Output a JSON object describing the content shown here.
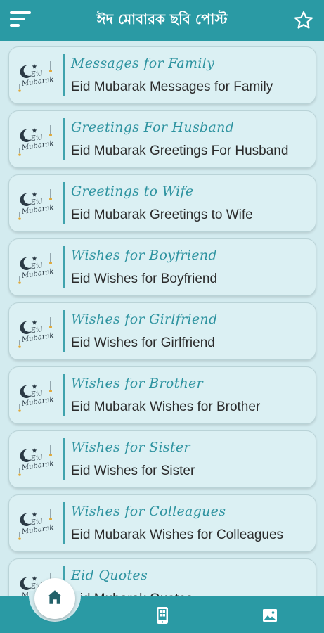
{
  "header": {
    "title": "ঈদ মোবারক ছবি পোস্ট",
    "menu_icon": "hamburger-menu-icon",
    "favorite_icon": "star-outline-icon"
  },
  "colors": {
    "primary": "#2a9aa4",
    "background": "#d3ebef",
    "card_title": "#2e93a0"
  },
  "list": {
    "items": [
      {
        "title": "Messages for Family",
        "subtitle": "Eid Mubarak Messages for Family",
        "thumb_text": "Eid Mubarak"
      },
      {
        "title": "Greetings For Husband",
        "subtitle": "Eid Mubarak Greetings For Husband",
        "thumb_text": "Eid Mubarak"
      },
      {
        "title": "Greetings to Wife",
        "subtitle": "Eid Mubarak Greetings to Wife",
        "thumb_text": "Eid Mubarak"
      },
      {
        "title": "Wishes for Boyfriend",
        "subtitle": "Eid Wishes for Boyfriend",
        "thumb_text": "Eid Mubarak"
      },
      {
        "title": "Wishes for Girlfriend",
        "subtitle": "Eid Wishes for Girlfriend",
        "thumb_text": "Eid Mubarak"
      },
      {
        "title": "Wishes for Brother",
        "subtitle": "Eid Mubarak Wishes for Brother",
        "thumb_text": "Eid Mubarak"
      },
      {
        "title": "Wishes for Sister",
        "subtitle": "Eid Wishes for Sister",
        "thumb_text": "Eid Mubarak"
      },
      {
        "title": "Wishes for Colleagues",
        "subtitle": "Eid Mubarak Wishes for Colleagues",
        "thumb_text": "Eid Mubarak"
      },
      {
        "title": "Eid Quotes",
        "subtitle": "Eid Mubarak Quotes",
        "thumb_text": "Eid Mubarak"
      }
    ]
  },
  "bottom_nav": {
    "items": [
      {
        "icon": "home-icon",
        "active": true
      },
      {
        "icon": "phone-apps-icon",
        "active": false
      },
      {
        "icon": "image-gallery-icon",
        "active": false
      }
    ]
  }
}
